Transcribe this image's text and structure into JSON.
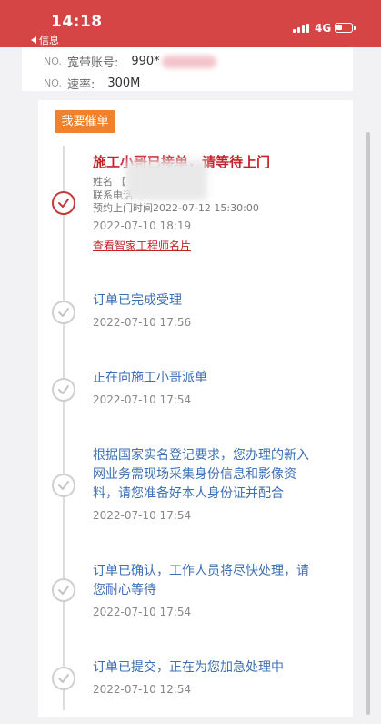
{
  "status_bar": {
    "time": "14:18",
    "back_label": "信息",
    "network": "4G"
  },
  "account_info": {
    "rows": [
      {
        "no": "NO.",
        "label": "宽带账号:",
        "value": "990*"
      },
      {
        "no": "NO.",
        "label": "速率:",
        "value": "300M"
      }
    ]
  },
  "urge_button": "我要催单",
  "active_event": {
    "title": "施工小哥已接单，请等待上门",
    "name_label": "姓名",
    "name_value": "【",
    "phone_label": "联系电话",
    "appointment_label": "预约上门时间",
    "appointment_value": "2022-07-12 15:30:00",
    "time": "2022-07-10 18:19",
    "engineer_link": "查看智家工程师名片"
  },
  "events": [
    {
      "title": "订单已完成受理",
      "time": "2022-07-10 17:56"
    },
    {
      "title": "正在向施工小哥派单",
      "time": "2022-07-10 17:54"
    },
    {
      "title": "根据国家实名登记要求，您办理的新入网业务需现场采集身份信息和影像资料，请您准备好本人身份证并配合",
      "time": "2022-07-10 17:54"
    },
    {
      "title": "订单已确认，工作人员将尽快处理，请您耐心等待",
      "time": "2022-07-10 17:54"
    },
    {
      "title": "订单已提交，正在为您加急处理中",
      "time": "2022-07-10 12:54"
    }
  ],
  "colors": {
    "status_bar": "#d64545",
    "urge_button": "#f0822e",
    "active_title": "#c2242b",
    "event_title": "#3d6fb4"
  },
  "icons": {
    "active_node": "check-circle-red-icon",
    "done_node": "check-circle-gray-icon",
    "signal": "signal-bars-icon",
    "battery": "battery-icon",
    "back": "back-arrow-icon"
  }
}
